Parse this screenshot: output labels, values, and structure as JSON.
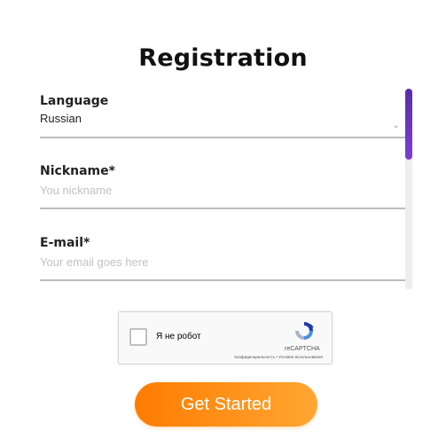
{
  "header": {
    "title": "Registration"
  },
  "form": {
    "language": {
      "label": "Language",
      "value": "Russian"
    },
    "nickname": {
      "label": "Nickname*",
      "placeholder": "You nickname"
    },
    "email": {
      "label": "E-mail*",
      "placeholder": "Your email goes here"
    }
  },
  "captcha": {
    "label": "Я не робот",
    "brand": "reCAPTCHA",
    "privacy": "Конфиденциальность • Условия использования"
  },
  "cta": {
    "label": "Get Started"
  },
  "colors": {
    "accent_start": "#ff7b00",
    "accent_end": "#ffa733",
    "scroll_thumb": "#6a35c0",
    "divider": "#bdbdbd",
    "placeholder": "#c2c2c2"
  },
  "icons": {
    "language_select": "chevron-down-icon",
    "captcha_logo": "recaptcha-logo-icon"
  }
}
